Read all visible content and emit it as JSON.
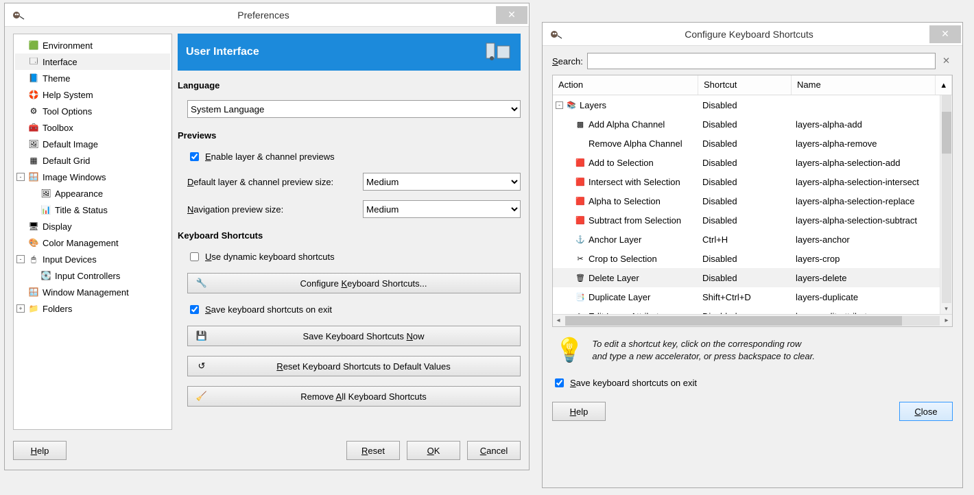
{
  "prefs": {
    "title": "Preferences",
    "section_title": "User Interface",
    "sidebar": [
      {
        "label": "Environment",
        "indent": 0,
        "exp": ""
      },
      {
        "label": "Interface",
        "indent": 0,
        "exp": "",
        "selected": true
      },
      {
        "label": "Theme",
        "indent": 0,
        "exp": ""
      },
      {
        "label": "Help System",
        "indent": 0,
        "exp": ""
      },
      {
        "label": "Tool Options",
        "indent": 0,
        "exp": ""
      },
      {
        "label": "Toolbox",
        "indent": 0,
        "exp": ""
      },
      {
        "label": "Default Image",
        "indent": 0,
        "exp": ""
      },
      {
        "label": "Default Grid",
        "indent": 0,
        "exp": ""
      },
      {
        "label": "Image Windows",
        "indent": 0,
        "exp": "-"
      },
      {
        "label": "Appearance",
        "indent": 1,
        "exp": ""
      },
      {
        "label": "Title & Status",
        "indent": 1,
        "exp": ""
      },
      {
        "label": "Display",
        "indent": 0,
        "exp": ""
      },
      {
        "label": "Color Management",
        "indent": 0,
        "exp": ""
      },
      {
        "label": "Input Devices",
        "indent": 0,
        "exp": "-"
      },
      {
        "label": "Input Controllers",
        "indent": 1,
        "exp": ""
      },
      {
        "label": "Window Management",
        "indent": 0,
        "exp": ""
      },
      {
        "label": "Folders",
        "indent": 0,
        "exp": "+"
      }
    ],
    "language": {
      "group": "Language",
      "value": "System Language"
    },
    "previews": {
      "group": "Previews",
      "enable_label": "Enable layer & channel previews",
      "enable_checked": true,
      "default_label": "Default layer & channel preview size:",
      "default_value": "Medium",
      "nav_label": "Navigation preview size:",
      "nav_value": "Medium"
    },
    "shortcuts": {
      "group": "Keyboard Shortcuts",
      "dynamic_label": "Use dynamic keyboard shortcuts",
      "dynamic_checked": false,
      "configure_btn": "Configure Keyboard Shortcuts...",
      "save_exit_label": "Save keyboard shortcuts on exit",
      "save_exit_checked": true,
      "save_now_btn": "Save Keyboard Shortcuts Now",
      "reset_btn": "Reset Keyboard Shortcuts to Default Values",
      "remove_btn": "Remove All Keyboard Shortcuts"
    },
    "footer": {
      "help": "Help",
      "reset": "Reset",
      "ok": "OK",
      "cancel": "Cancel"
    }
  },
  "cfg": {
    "title": "Configure Keyboard Shortcuts",
    "search_label": "Search:",
    "columns": {
      "action": "Action",
      "shortcut": "Shortcut",
      "name": "Name"
    },
    "rows": [
      {
        "exp": "-",
        "indent": 0,
        "action": "Layers",
        "shortcut": "Disabled",
        "name": ""
      },
      {
        "indent": 1,
        "action": "Add Alpha Channel",
        "shortcut": "Disabled",
        "name": "layers-alpha-add"
      },
      {
        "indent": 1,
        "action": "Remove Alpha Channel",
        "shortcut": "Disabled",
        "name": "layers-alpha-remove"
      },
      {
        "indent": 1,
        "action": "Add to Selection",
        "shortcut": "Disabled",
        "name": "layers-alpha-selection-add"
      },
      {
        "indent": 1,
        "action": "Intersect with Selection",
        "shortcut": "Disabled",
        "name": "layers-alpha-selection-intersect"
      },
      {
        "indent": 1,
        "action": "Alpha to Selection",
        "shortcut": "Disabled",
        "name": "layers-alpha-selection-replace"
      },
      {
        "indent": 1,
        "action": "Subtract from Selection",
        "shortcut": "Disabled",
        "name": "layers-alpha-selection-subtract"
      },
      {
        "indent": 1,
        "action": "Anchor Layer",
        "shortcut": "Ctrl+H",
        "name": "layers-anchor"
      },
      {
        "indent": 1,
        "action": "Crop to Selection",
        "shortcut": "Disabled",
        "name": "layers-crop"
      },
      {
        "indent": 1,
        "action": "Delete Layer",
        "shortcut": "Disabled",
        "name": "layers-delete",
        "selected": true
      },
      {
        "indent": 1,
        "action": "Duplicate Layer",
        "shortcut": "Shift+Ctrl+D",
        "name": "layers-duplicate"
      },
      {
        "indent": 1,
        "action": "Edit Layer Attributes...",
        "shortcut": "Disabled",
        "name": "layers-edit-attributes"
      }
    ],
    "hint_line1": "To edit a shortcut key, click on the corresponding row",
    "hint_line2": "and type a new accelerator, or press backspace to clear.",
    "save_exit_label": "Save keyboard shortcuts on exit",
    "save_exit_checked": true,
    "footer": {
      "help": "Help",
      "close": "Close"
    }
  }
}
